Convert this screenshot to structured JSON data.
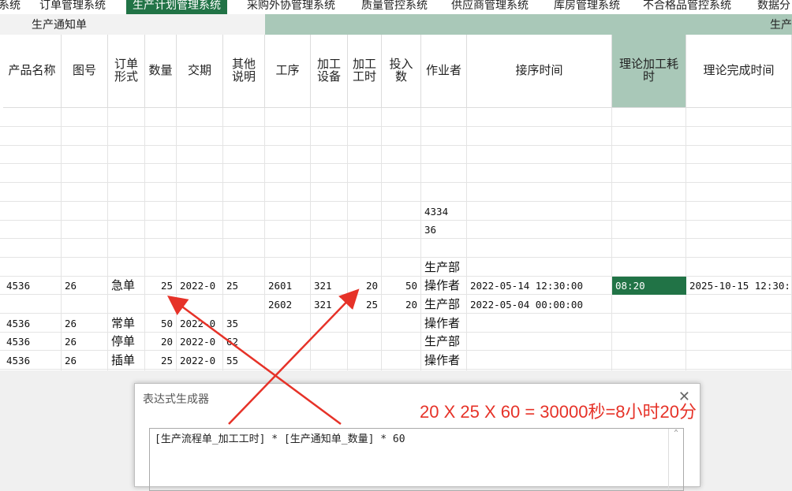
{
  "tabs": [
    {
      "label": "系统"
    },
    {
      "label": "订单管理系统"
    },
    {
      "label": "生产计划管理系统"
    },
    {
      "label": "采购外协管理系统"
    },
    {
      "label": "质量管控系统"
    },
    {
      "label": "供应商管理系统"
    },
    {
      "label": "库房管理系统"
    },
    {
      "label": "不合格品管控系统"
    },
    {
      "label": "数据分"
    }
  ],
  "sections": {
    "left": "生产通知单",
    "right": "生产"
  },
  "headers": [
    "产品名称",
    "图号",
    "订单\n形式",
    "数量",
    "交期",
    "其他\n说明",
    "工序",
    "加工\n设备",
    "加工\n工时",
    "投入\n数",
    "作业者",
    "接序时间",
    "理论加工耗\n时",
    "理论完成时间"
  ],
  "rows": [
    {
      "cells": {
        "worker": "4334"
      }
    },
    {
      "cells": {
        "worker": "36"
      }
    },
    {
      "cells": {
        "worker": "生产部"
      }
    },
    {
      "cells": {
        "name": "4536",
        "drawing": "26",
        "order": "急单",
        "qty": "25",
        "due": "2022-0",
        "note": "25",
        "proc": "2601",
        "equip": "321",
        "hours": "20",
        "input": "50",
        "worker": "操作者",
        "seq_time": "2022-05-14 12:30:00",
        "theory_time": "08:20",
        "finish": "2025-10-15 12:30:"
      }
    },
    {
      "cells": {
        "proc": "2602",
        "equip": "321",
        "hours": "25",
        "input": "20",
        "worker": "生产部",
        "seq_time": "2022-05-04 00:00:00"
      }
    },
    {
      "cells": {
        "name": "4536",
        "drawing": "26",
        "order": "常单",
        "qty": "50",
        "due": "2022-0",
        "note": "35",
        "worker": "操作者"
      }
    },
    {
      "cells": {
        "name": "4536",
        "drawing": "26",
        "order": "停单",
        "qty": "20",
        "due": "2022-0",
        "note": "62",
        "worker": "生产部"
      }
    },
    {
      "cells": {
        "name": "4536",
        "drawing": "26",
        "order": "插单",
        "qty": "25",
        "due": "2022-0",
        "note": "55",
        "worker": "操作者"
      }
    }
  ],
  "dialog": {
    "title": "表达式生成器",
    "close_icon": "close-icon",
    "expression": "[生产流程单_加工工时] * [生产通知单_数量] * 60"
  },
  "annotation": {
    "text": "20 X 25 X 60 = 30000秒=8小时20分",
    "color": "#e63228"
  },
  "colors": {
    "accent": "#217346",
    "header_green": "#a9c8b8"
  }
}
